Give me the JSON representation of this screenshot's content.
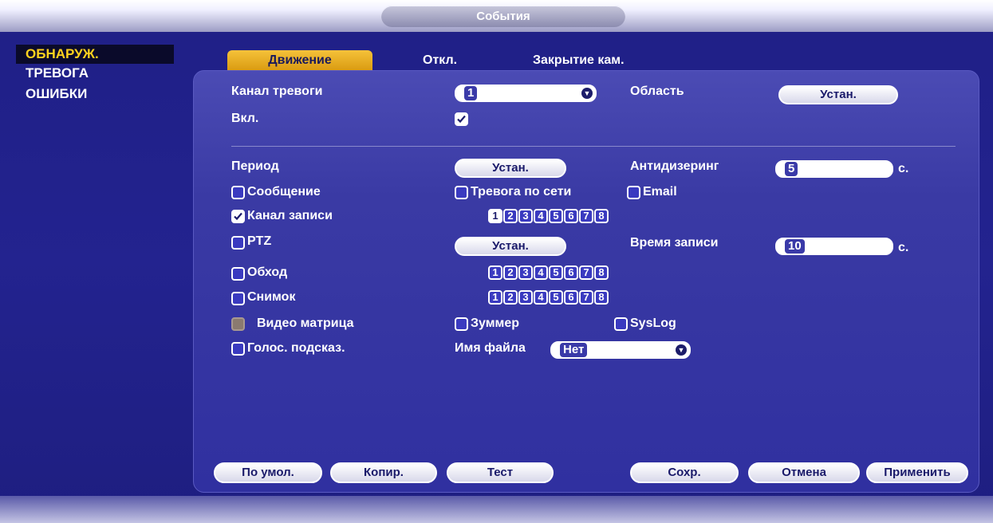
{
  "window": {
    "title": "События"
  },
  "sidebar": {
    "items": [
      {
        "label": "ОБНАРУЖ.",
        "active": true
      },
      {
        "label": "ТРЕВОГА"
      },
      {
        "label": "ОШИБКИ"
      }
    ]
  },
  "tabs": [
    {
      "label": "Движение",
      "active": true
    },
    {
      "label": "Откл."
    },
    {
      "label": "Закрытие кам."
    }
  ],
  "form": {
    "alarm_channel_label": "Канал тревоги",
    "alarm_channel_value": "1",
    "area_label": "Область",
    "area_button": "Устан.",
    "enable_label": "Вкл.",
    "enable_checked": true,
    "period_label": "Период",
    "period_button": "Устан.",
    "antidither_label": "Антидизеринг",
    "antidither_value": "5",
    "antidither_unit": "с.",
    "message_label": "Сообщение",
    "net_alarm_label": "Тревога по сети",
    "email_label": "Email",
    "record_channel_label": "Канал записи",
    "record_channel_checked": true,
    "ptz_label": "PTZ",
    "ptz_button": "Устан.",
    "record_time_label": "Время записи",
    "record_time_value": "10",
    "record_time_unit": "с.",
    "tour_label": "Обход",
    "snapshot_label": "Снимок",
    "video_matrix_label": "Видео матрица",
    "buzzer_label": "Зуммер",
    "syslog_label": "SysLog",
    "voice_prompt_label": "Голос. подсказ.",
    "file_name_label": "Имя файла",
    "file_name_value": "Нет",
    "channels": [
      "1",
      "2",
      "3",
      "4",
      "5",
      "6",
      "7",
      "8"
    ],
    "record_channels_selected": [
      "1"
    ]
  },
  "footer": {
    "default_label": "По умол.",
    "copy_label": "Копир.",
    "test_label": "Тест",
    "save_label": "Сохр.",
    "cancel_label": "Отмена",
    "apply_label": "Применить"
  }
}
